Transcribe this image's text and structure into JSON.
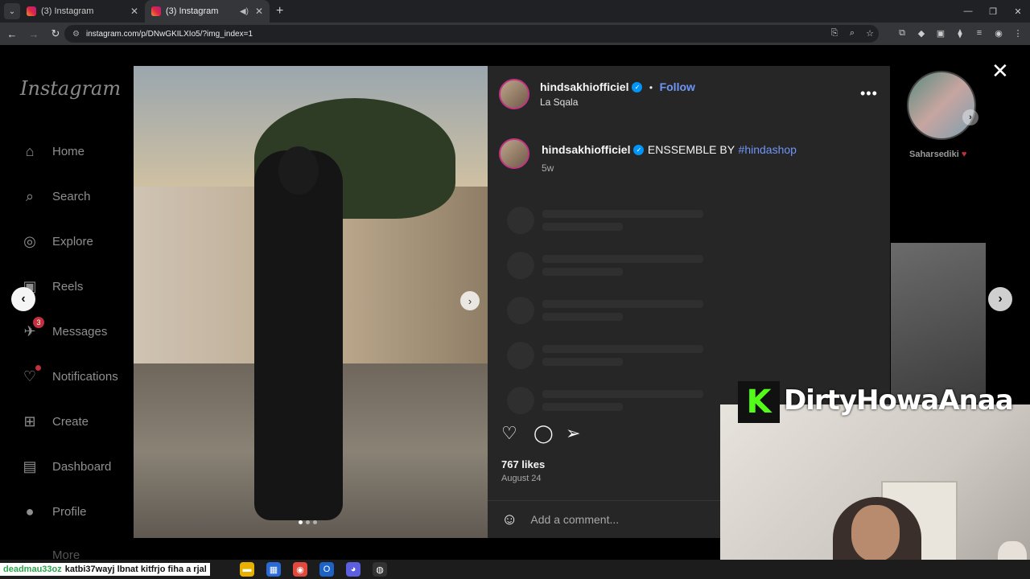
{
  "browser": {
    "tabs": [
      {
        "title": "(3) Instagram",
        "active": false
      },
      {
        "title": "(3) Instagram",
        "active": true
      }
    ],
    "url": "instagram.com/p/DNwGKILXIo5/?img_index=1"
  },
  "sidebar": {
    "logo": "Instagram",
    "items": [
      {
        "label": "Home",
        "icon": "home-icon"
      },
      {
        "label": "Search",
        "icon": "search-icon"
      },
      {
        "label": "Explore",
        "icon": "compass-icon"
      },
      {
        "label": "Reels",
        "icon": "reels-icon"
      },
      {
        "label": "Messages",
        "icon": "messenger-icon",
        "badge": "3"
      },
      {
        "label": "Notifications",
        "icon": "heart-icon"
      },
      {
        "label": "Create",
        "icon": "plus-square-icon"
      },
      {
        "label": "Dashboard",
        "icon": "dashboard-icon"
      },
      {
        "label": "Profile",
        "icon": "avatar-icon"
      },
      {
        "label": "More",
        "icon": "menu-icon"
      }
    ]
  },
  "post": {
    "username": "hindsakhiofficiel",
    "follow_label": "Follow",
    "separator": "•",
    "location": "La Sqala",
    "caption_text": "ENSSEMBLE BY",
    "caption_hashtag": "#hindashop",
    "caption_age": "5w",
    "likes": "767 likes",
    "date": "August 24",
    "comment_placeholder": "Add a comment..."
  },
  "side_story": {
    "name": "Saharsediki"
  },
  "stream": {
    "streamer": "DirtyHowaAnaa",
    "ticker_user": "deadmau33oz",
    "ticker_text": "katbi37wayj lbnat kitfrjo fiha a rjal"
  },
  "colors": {
    "accent": "#0095f6",
    "link": "#6f95f6",
    "kick_green": "#53fc18",
    "badge_red": "#c2303e"
  }
}
